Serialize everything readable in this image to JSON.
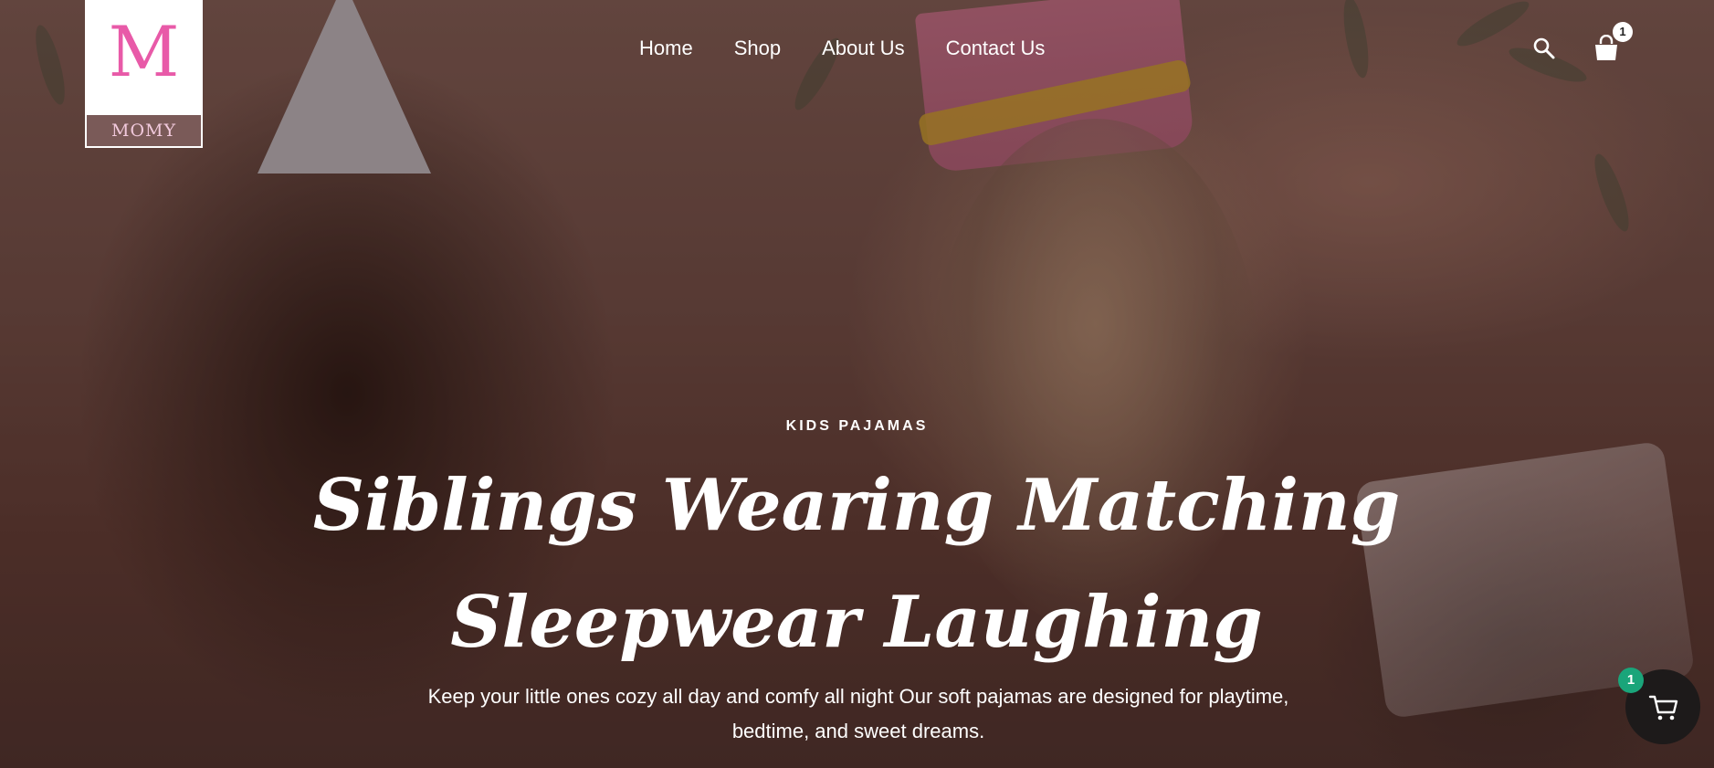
{
  "brand": {
    "logo_letter": "M",
    "name": "MOMY"
  },
  "nav": {
    "items": [
      {
        "label": "Home"
      },
      {
        "label": "Shop"
      },
      {
        "label": "About Us"
      },
      {
        "label": "Contact Us"
      }
    ]
  },
  "header_icons": {
    "search_icon": "search-icon",
    "cart_icon": "shopping-bag-icon",
    "cart_count": "1"
  },
  "hero": {
    "eyebrow": "KIDS PAJAMAS",
    "headline_line1": "Siblings Wearing Matching",
    "headline_line2": "Sleepwear Laughing",
    "subtext_line1": "Keep your little ones cozy all day and comfy all night Our soft pajamas are designed for playtime,",
    "subtext_line2": "bedtime, and sweet dreams."
  },
  "floating_cart": {
    "icon": "cart-icon",
    "count": "1"
  },
  "colors": {
    "accent_pink": "#e85aa8",
    "badge_green": "#1aa57a",
    "floating_button_bg": "#1d1a1a"
  }
}
